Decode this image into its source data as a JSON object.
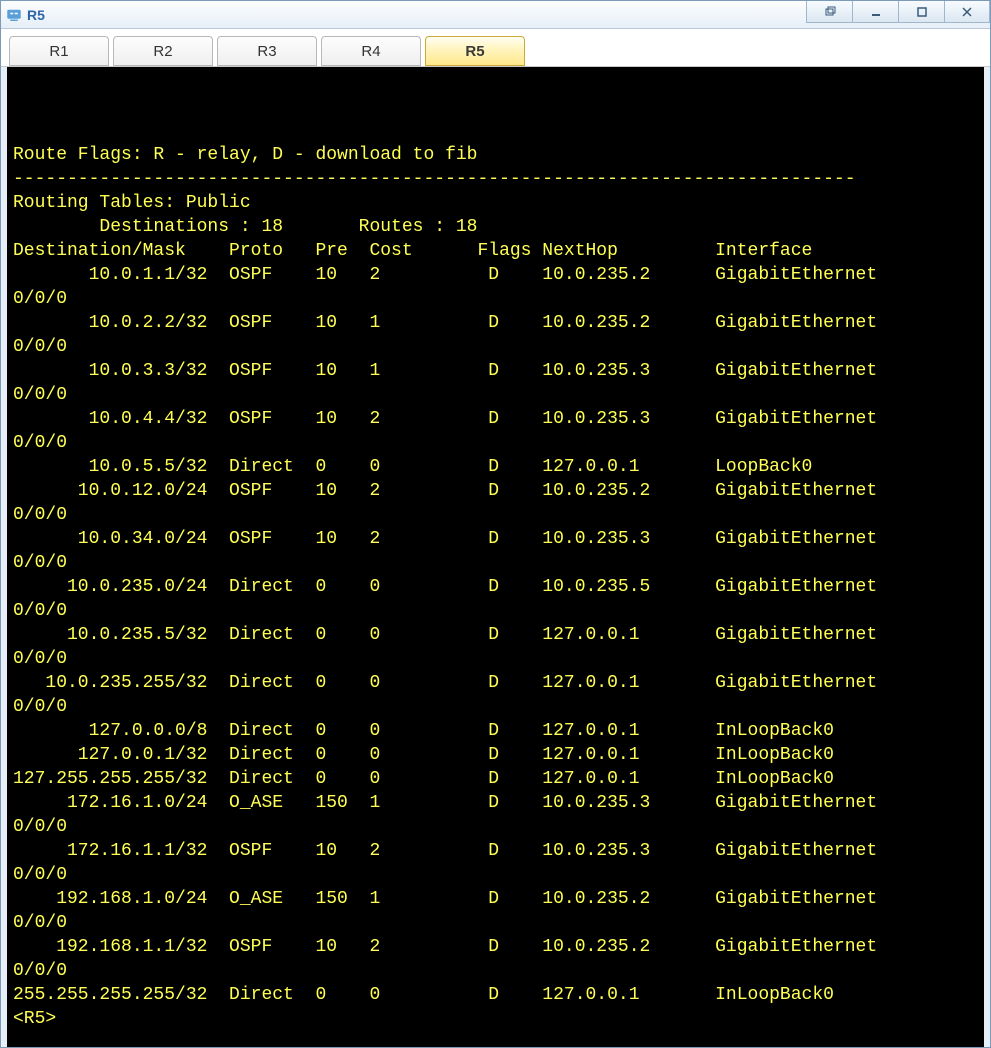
{
  "window": {
    "title": "R5"
  },
  "tabs": [
    "R1",
    "R2",
    "R3",
    "R4",
    "R5"
  ],
  "active_tab_index": 4,
  "terminal": {
    "route_flags_line": "Route Flags: R - relay, D - download to fib",
    "dash_line": "------------------------------------------------------------------------------",
    "routing_tables_line": "Routing Tables: Public",
    "destinations_label": "Destinations :",
    "destinations_value": "18",
    "routes_label": "Routes :",
    "routes_value": "18",
    "headers": {
      "dest": "Destination/Mask",
      "proto": "Proto",
      "pre": "Pre",
      "cost": "Cost",
      "flags": "Flags",
      "nexthop": "NextHop",
      "interface": "Interface"
    },
    "rows": [
      {
        "dest": "10.0.1.1/32",
        "proto": "OSPF",
        "pre": "10",
        "cost": "2",
        "flags": "D",
        "next": "10.0.235.2",
        "intf": "GigabitEthernet",
        "wrap": "0/0/0"
      },
      {
        "dest": "10.0.2.2/32",
        "proto": "OSPF",
        "pre": "10",
        "cost": "1",
        "flags": "D",
        "next": "10.0.235.2",
        "intf": "GigabitEthernet",
        "wrap": "0/0/0"
      },
      {
        "dest": "10.0.3.3/32",
        "proto": "OSPF",
        "pre": "10",
        "cost": "1",
        "flags": "D",
        "next": "10.0.235.3",
        "intf": "GigabitEthernet",
        "wrap": "0/0/0"
      },
      {
        "dest": "10.0.4.4/32",
        "proto": "OSPF",
        "pre": "10",
        "cost": "2",
        "flags": "D",
        "next": "10.0.235.3",
        "intf": "GigabitEthernet",
        "wrap": "0/0/0"
      },
      {
        "dest": "10.0.5.5/32",
        "proto": "Direct",
        "pre": "0",
        "cost": "0",
        "flags": "D",
        "next": "127.0.0.1",
        "intf": "LoopBack0",
        "wrap": null
      },
      {
        "dest": "10.0.12.0/24",
        "proto": "OSPF",
        "pre": "10",
        "cost": "2",
        "flags": "D",
        "next": "10.0.235.2",
        "intf": "GigabitEthernet",
        "wrap": "0/0/0"
      },
      {
        "dest": "10.0.34.0/24",
        "proto": "OSPF",
        "pre": "10",
        "cost": "2",
        "flags": "D",
        "next": "10.0.235.3",
        "intf": "GigabitEthernet",
        "wrap": "0/0/0"
      },
      {
        "dest": "10.0.235.0/24",
        "proto": "Direct",
        "pre": "0",
        "cost": "0",
        "flags": "D",
        "next": "10.0.235.5",
        "intf": "GigabitEthernet",
        "wrap": "0/0/0"
      },
      {
        "dest": "10.0.235.5/32",
        "proto": "Direct",
        "pre": "0",
        "cost": "0",
        "flags": "D",
        "next": "127.0.0.1",
        "intf": "GigabitEthernet",
        "wrap": "0/0/0"
      },
      {
        "dest": "10.0.235.255/32",
        "proto": "Direct",
        "pre": "0",
        "cost": "0",
        "flags": "D",
        "next": "127.0.0.1",
        "intf": "GigabitEthernet",
        "wrap": "0/0/0"
      },
      {
        "dest": "127.0.0.0/8",
        "proto": "Direct",
        "pre": "0",
        "cost": "0",
        "flags": "D",
        "next": "127.0.0.1",
        "intf": "InLoopBack0",
        "wrap": null
      },
      {
        "dest": "127.0.0.1/32",
        "proto": "Direct",
        "pre": "0",
        "cost": "0",
        "flags": "D",
        "next": "127.0.0.1",
        "intf": "InLoopBack0",
        "wrap": null
      },
      {
        "dest": "127.255.255.255/32",
        "proto": "Direct",
        "pre": "0",
        "cost": "0",
        "flags": "D",
        "next": "127.0.0.1",
        "intf": "InLoopBack0",
        "wrap": null
      },
      {
        "dest": "172.16.1.0/24",
        "proto": "O_ASE",
        "pre": "150",
        "cost": "1",
        "flags": "D",
        "next": "10.0.235.3",
        "intf": "GigabitEthernet",
        "wrap": "0/0/0"
      },
      {
        "dest": "172.16.1.1/32",
        "proto": "OSPF",
        "pre": "10",
        "cost": "2",
        "flags": "D",
        "next": "10.0.235.3",
        "intf": "GigabitEthernet",
        "wrap": "0/0/0"
      },
      {
        "dest": "192.168.1.0/24",
        "proto": "O_ASE",
        "pre": "150",
        "cost": "1",
        "flags": "D",
        "next": "10.0.235.2",
        "intf": "GigabitEthernet",
        "wrap": "0/0/0"
      },
      {
        "dest": "192.168.1.1/32",
        "proto": "OSPF",
        "pre": "10",
        "cost": "2",
        "flags": "D",
        "next": "10.0.235.2",
        "intf": "GigabitEthernet",
        "wrap": "0/0/0"
      },
      {
        "dest": "255.255.255.255/32",
        "proto": "Direct",
        "pre": "0",
        "cost": "0",
        "flags": "D",
        "next": "127.0.0.1",
        "intf": "InLoopBack0",
        "wrap": null
      }
    ],
    "prompt": "<R5>"
  }
}
